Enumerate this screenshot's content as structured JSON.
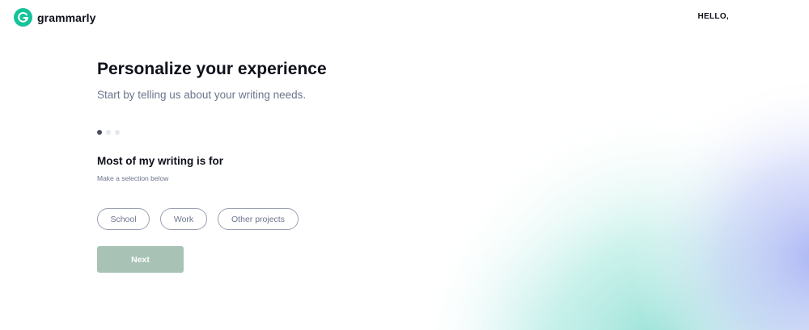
{
  "header": {
    "logo_text": "grammarly",
    "greeting": "HELLO,"
  },
  "main": {
    "title": "Personalize your experience",
    "subtitle": "Start by telling us about your writing needs.",
    "progress": {
      "current_step": 1,
      "total_steps": 3
    },
    "question": "Most of my writing is for",
    "hint": "Make a selection below",
    "options": [
      {
        "label": "School"
      },
      {
        "label": "Work"
      },
      {
        "label": "Other projects"
      }
    ],
    "next_label": "Next"
  },
  "colors": {
    "brand_green": "#15c39a",
    "next_disabled": "#a8c3b6",
    "text_primary": "#0e101a",
    "text_secondary": "#6d758d"
  },
  "icons": {
    "logo": "grammarly-g-icon"
  }
}
